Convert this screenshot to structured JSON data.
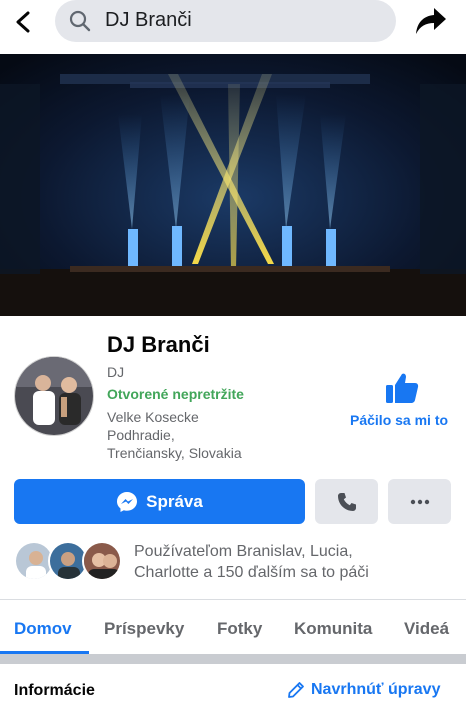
{
  "search": {
    "query": "DJ Branči"
  },
  "page": {
    "name": "DJ Branči",
    "category": "DJ",
    "open_status": "Otvorené nepretržite",
    "address_lines": [
      "Velke Kosecke",
      "Podhradie,",
      "Trenčiansky, Slovakia"
    ]
  },
  "actions": {
    "like_label": "Páčilo sa mi to",
    "message_label": "Správa"
  },
  "likes_summary": {
    "line1": "Používateľom Branislav, Lucia,",
    "line2": "Charlotte a 150 ďalším sa to páči"
  },
  "tabs": [
    {
      "label": "Domov",
      "active": true
    },
    {
      "label": "Príspevky",
      "active": false
    },
    {
      "label": "Fotky",
      "active": false
    },
    {
      "label": "Komunita",
      "active": false
    },
    {
      "label": "Videá",
      "active": false
    }
  ],
  "info": {
    "title": "Informácie",
    "suggest_edit_label": "Navrhnúť úpravy"
  },
  "colors": {
    "accent": "#1877f2",
    "open_green": "#42a65a",
    "button_grey": "#e4e6eb"
  },
  "icons": [
    "back-arrow-icon",
    "search-icon",
    "share-icon",
    "thumbs-up-icon",
    "messenger-icon",
    "phone-icon",
    "more-dots-icon",
    "pencil-icon"
  ]
}
